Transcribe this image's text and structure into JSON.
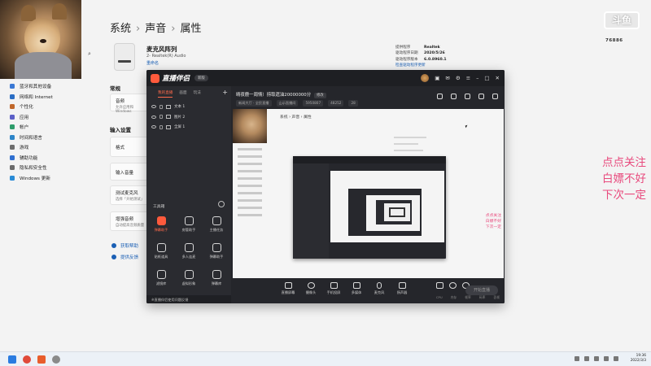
{
  "settings": {
    "breadcrumb": [
      "系统",
      "声音",
      "属性"
    ],
    "device_name": "麦克风阵列",
    "device_sub": "2- Realtek(R) Audio",
    "rename_label": "重命名",
    "info": [
      {
        "k": "提供程序",
        "v": "Realtek"
      },
      {
        "k": "驱动程序日期",
        "v": "2020/5/26"
      },
      {
        "k": "驱动程序版本",
        "v": "6.0.8960.1"
      }
    ],
    "info_link": "检查驱动程序更新",
    "general_title": "常规",
    "audio_card": {
      "title": "音频",
      "sub": "允许应用和 Windows"
    },
    "input_title": "输入设置",
    "format_label": "格式",
    "input_volume_label": "输入音量",
    "test_card": {
      "title": "测试麦克风",
      "sub": "选择「开始测试」"
    },
    "enhance_card": {
      "title": "增强音频",
      "sub": "自动提高音频质量"
    },
    "help_links": [
      "获取帮助",
      "提供反馈"
    ],
    "sidebar": [
      {
        "label": "蓝牙和其他设备",
        "color": "#3a78d4"
      },
      {
        "label": "网络和 Internet",
        "color": "#2a6dc4"
      },
      {
        "label": "个性化",
        "color": "#c0672a"
      },
      {
        "label": "应用",
        "color": "#5b5fc7"
      },
      {
        "label": "帐户",
        "color": "#2e9c6a"
      },
      {
        "label": "时间和语言",
        "color": "#2d84c8"
      },
      {
        "label": "游戏",
        "color": "#6d6d6d"
      },
      {
        "label": "辅助功能",
        "color": "#2f6fd0"
      },
      {
        "label": "隐私和安全性",
        "color": "#6a6a6a"
      },
      {
        "label": "Windows 更新",
        "color": "#2a8bd6"
      }
    ]
  },
  "brand": {
    "logo_text": "斗鱼",
    "sub_text": "76886"
  },
  "overlay_text": [
    "点点关注",
    "白嫖不好",
    "下次一定"
  ],
  "app": {
    "logo": "直播伴侣",
    "version": "新版",
    "source_tabs": [
      "我的直播",
      "画面",
      "玩法"
    ],
    "sources": [
      "文本 1",
      "图片 2",
      "全屏 1"
    ],
    "tools_title": "工具箱",
    "tools": [
      {
        "label": "弹幕助手",
        "hot": true
      },
      {
        "label": "房管助手",
        "hot": false
      },
      {
        "label": "主播任务",
        "hot": false
      },
      {
        "label": "贴纸道具",
        "hot": false
      },
      {
        "label": "多人连麦",
        "hot": false
      },
      {
        "label": "弹幕助手",
        "hot": false
      },
      {
        "label": "滤镜库",
        "hot": false
      },
      {
        "label": "虚拟形象",
        "hot": false
      },
      {
        "label": "弹幕库",
        "hot": false
      }
    ],
    "notice": "※直播伴侣使用问题反馈",
    "stream_title": "晴夜鹿一周情）捞取遗油20000000分",
    "stream_tag": "修改",
    "stream_meta": [
      "新闻大厅 · 全民直播",
      "山示直播间",
      "5950807",
      "48252",
      "28"
    ],
    "preview_crumb": "系统 › 声音 › 属性",
    "preview_overlay": [
      "点点关注",
      "白嫖不好",
      "下次一定"
    ],
    "bottom_items": [
      "直播屏幕",
      "摄像头",
      "手机投屏",
      "多媒体",
      "麦克风",
      "扬声器"
    ],
    "go_live": "开始直播",
    "status": [
      "CPU",
      "内存",
      "帧率",
      "码率",
      "丢帧"
    ]
  },
  "taskbar": {
    "time": "19:36",
    "date": "2022/3/3"
  }
}
